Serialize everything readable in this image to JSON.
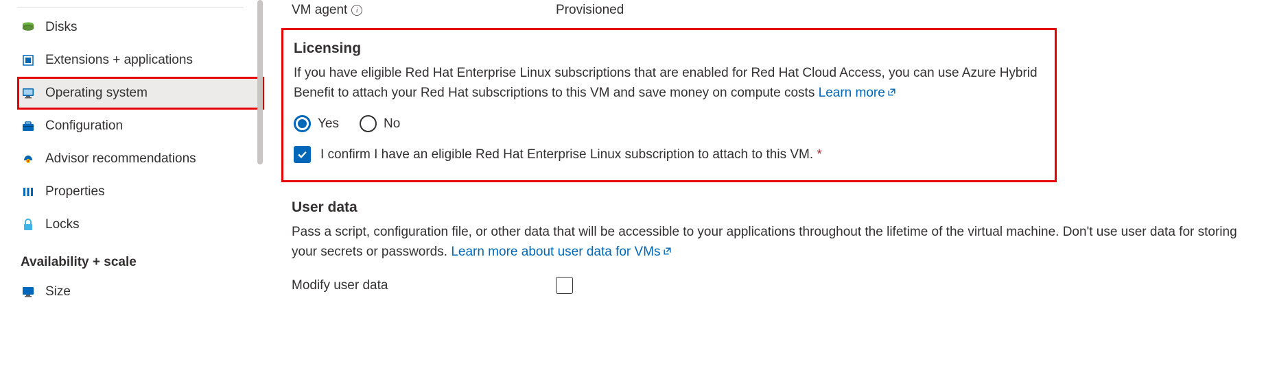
{
  "sidebar": {
    "items": [
      {
        "label": "Disks"
      },
      {
        "label": "Extensions + applications"
      },
      {
        "label": "Operating system"
      },
      {
        "label": "Configuration"
      },
      {
        "label": "Advisor recommendations"
      },
      {
        "label": "Properties"
      },
      {
        "label": "Locks"
      }
    ],
    "section_header": "Availability + scale",
    "section_items": [
      {
        "label": "Size"
      }
    ]
  },
  "main": {
    "vm_agent": {
      "label": "VM agent",
      "value": "Provisioned"
    },
    "licensing": {
      "title": "Licensing",
      "desc": "If you have eligible Red Hat Enterprise Linux subscriptions that are enabled for Red Hat Cloud Access, you can use Azure Hybrid Benefit to attach your Red Hat subscriptions to this VM and save money on compute costs  ",
      "learn_more": "Learn more",
      "yes": "Yes",
      "no": "No",
      "confirm": "I confirm I have an eligible Red Hat Enterprise Linux subscription to attach to this VM.",
      "req": " *"
    },
    "userdata": {
      "title": "User data",
      "desc": "Pass a script, configuration file, or other data that will be accessible to your applications throughout the lifetime of the virtual machine. Don't use user data for storing your secrets or passwords.  ",
      "learn_more": "Learn more about user data for VMs",
      "modify_label": "Modify user data"
    }
  }
}
